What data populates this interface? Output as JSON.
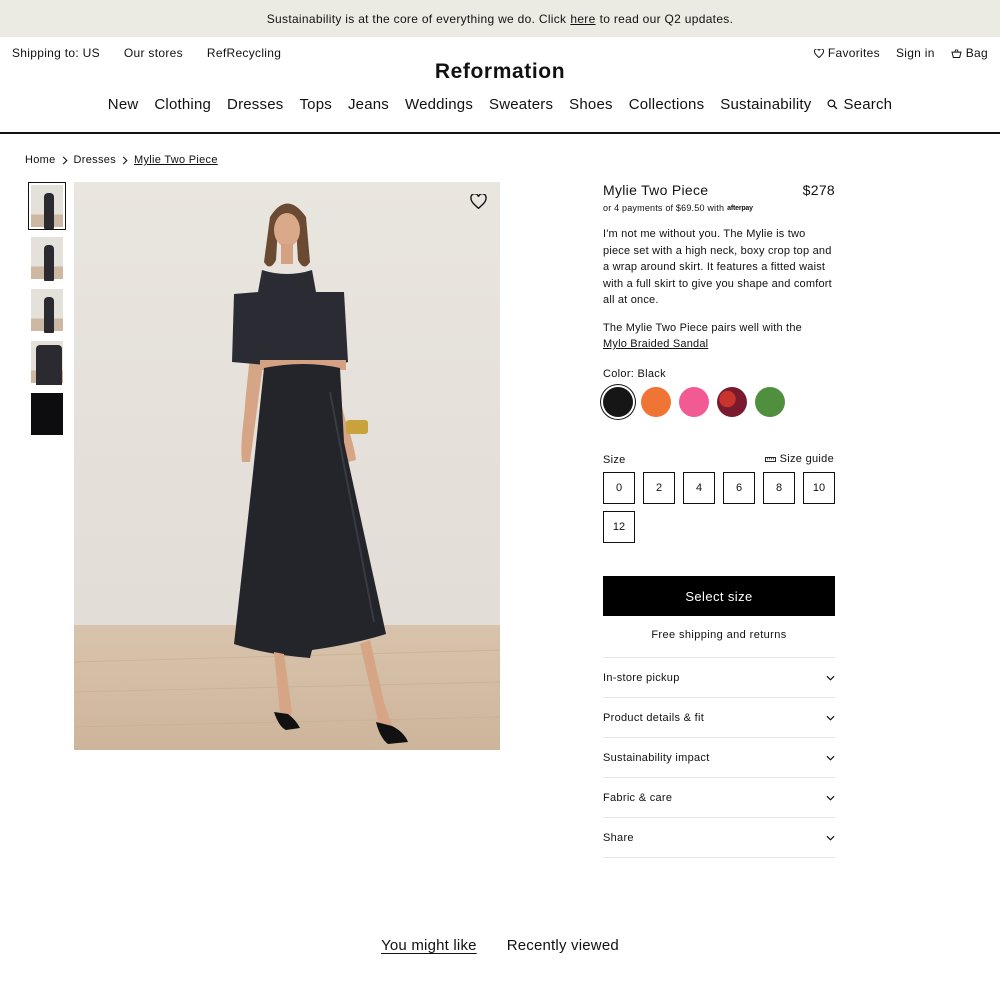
{
  "announcement": {
    "text_before": "Sustainability is at the core of everything we do. Click",
    "link": "here",
    "text_after": "to read our Q2 updates."
  },
  "utility": {
    "left": [
      "Shipping to: US",
      "Our stores",
      "RefRecycling"
    ],
    "favorites": "Favorites",
    "sign_in": "Sign in",
    "bag": "Bag"
  },
  "logo": "Reformation",
  "nav": {
    "items": [
      "New",
      "Clothing",
      "Dresses",
      "Tops",
      "Jeans",
      "Weddings",
      "Sweaters",
      "Shoes",
      "Collections",
      "Sustainability"
    ],
    "search": "Search"
  },
  "breadcrumb": [
    "Home",
    "Dresses",
    "Mylie Two Piece"
  ],
  "product": {
    "name": "Mylie Two Piece",
    "price": "$278",
    "installments": "or 4 payments of $69.50 with",
    "afterpay": "afterpay",
    "description": "I'm not me without you. The Mylie is two piece set with a high neck, boxy crop top and a wrap around skirt. It features a fitted waist with a full skirt to give you shape and comfort all at once.",
    "pairs_text": "The Mylie Two Piece pairs well with the",
    "pairs_link": "Mylo Braided Sandal",
    "color_label": "Color: Black",
    "colors": [
      "#161616",
      "#f07433",
      "#f25a93",
      "#7a1a2e",
      "#4f8f3d"
    ],
    "size_label": "Size",
    "size_guide": "Size guide",
    "sizes": [
      "0",
      "2",
      "4",
      "6",
      "8",
      "10",
      "12"
    ],
    "cta": "Select size",
    "free_shipping": "Free shipping and returns"
  },
  "accordion": [
    "In-store pickup",
    "Product details & fit",
    "Sustainability impact",
    "Fabric & care",
    "Share"
  ],
  "tabs": [
    "You might like",
    "Recently viewed"
  ]
}
